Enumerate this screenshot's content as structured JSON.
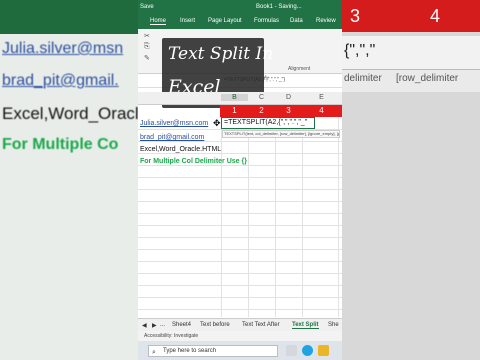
{
  "background": {
    "left_lines": [
      "Julia.silver@msn",
      "brad_pit@gmail.",
      "Excel,Word_Oracle",
      "For Multiple Co"
    ],
    "right_numbers": [
      "3",
      "4"
    ],
    "right_formula": "{\",\",\"",
    "right_headers": [
      "delimiter",
      "[row_delimiter"
    ]
  },
  "window": {
    "app_fragment": "Save",
    "title": "Book1 - Saving..."
  },
  "ribbon": {
    "tabs": [
      "Home",
      "Insert",
      "Page Layout",
      "Formulas",
      "Data",
      "Review"
    ],
    "active_tab": "Home",
    "alignment_label": "Alignment"
  },
  "overlay": {
    "line1": "Text Split In",
    "line2": "Excel"
  },
  "formula_bar": {
    "fx": "fx",
    "text": "=TEXTSPLIT(A2,{\",\",\".\",\"_\"}"
  },
  "columns": [
    "B",
    "C",
    "D",
    "E"
  ],
  "red_row": [
    "1",
    "2",
    "3",
    "4"
  ],
  "cells": {
    "a2": "Julia.silver@msn.com",
    "a3": "brad_pit@gmail.com",
    "a4": "Excel,Word_Oracle.HTML",
    "a5": "For Multiple Col Delimiter Use {}",
    "b2": "=TEXTSPLIT(A2,{\",\",\".\",\"_\"",
    "tooltip": "TEXTSPLIT(text, col_delimiter, [row_delimiter], [ignore_empty], [pad_with])"
  },
  "sheets": [
    "...",
    "Sheet4",
    "Text before",
    "Text Text After",
    "Text Split",
    "She"
  ],
  "active_sheet": "Text Split",
  "status": "Accessibility: Investigate",
  "taskbar": {
    "search_placeholder": "Type here to search"
  }
}
